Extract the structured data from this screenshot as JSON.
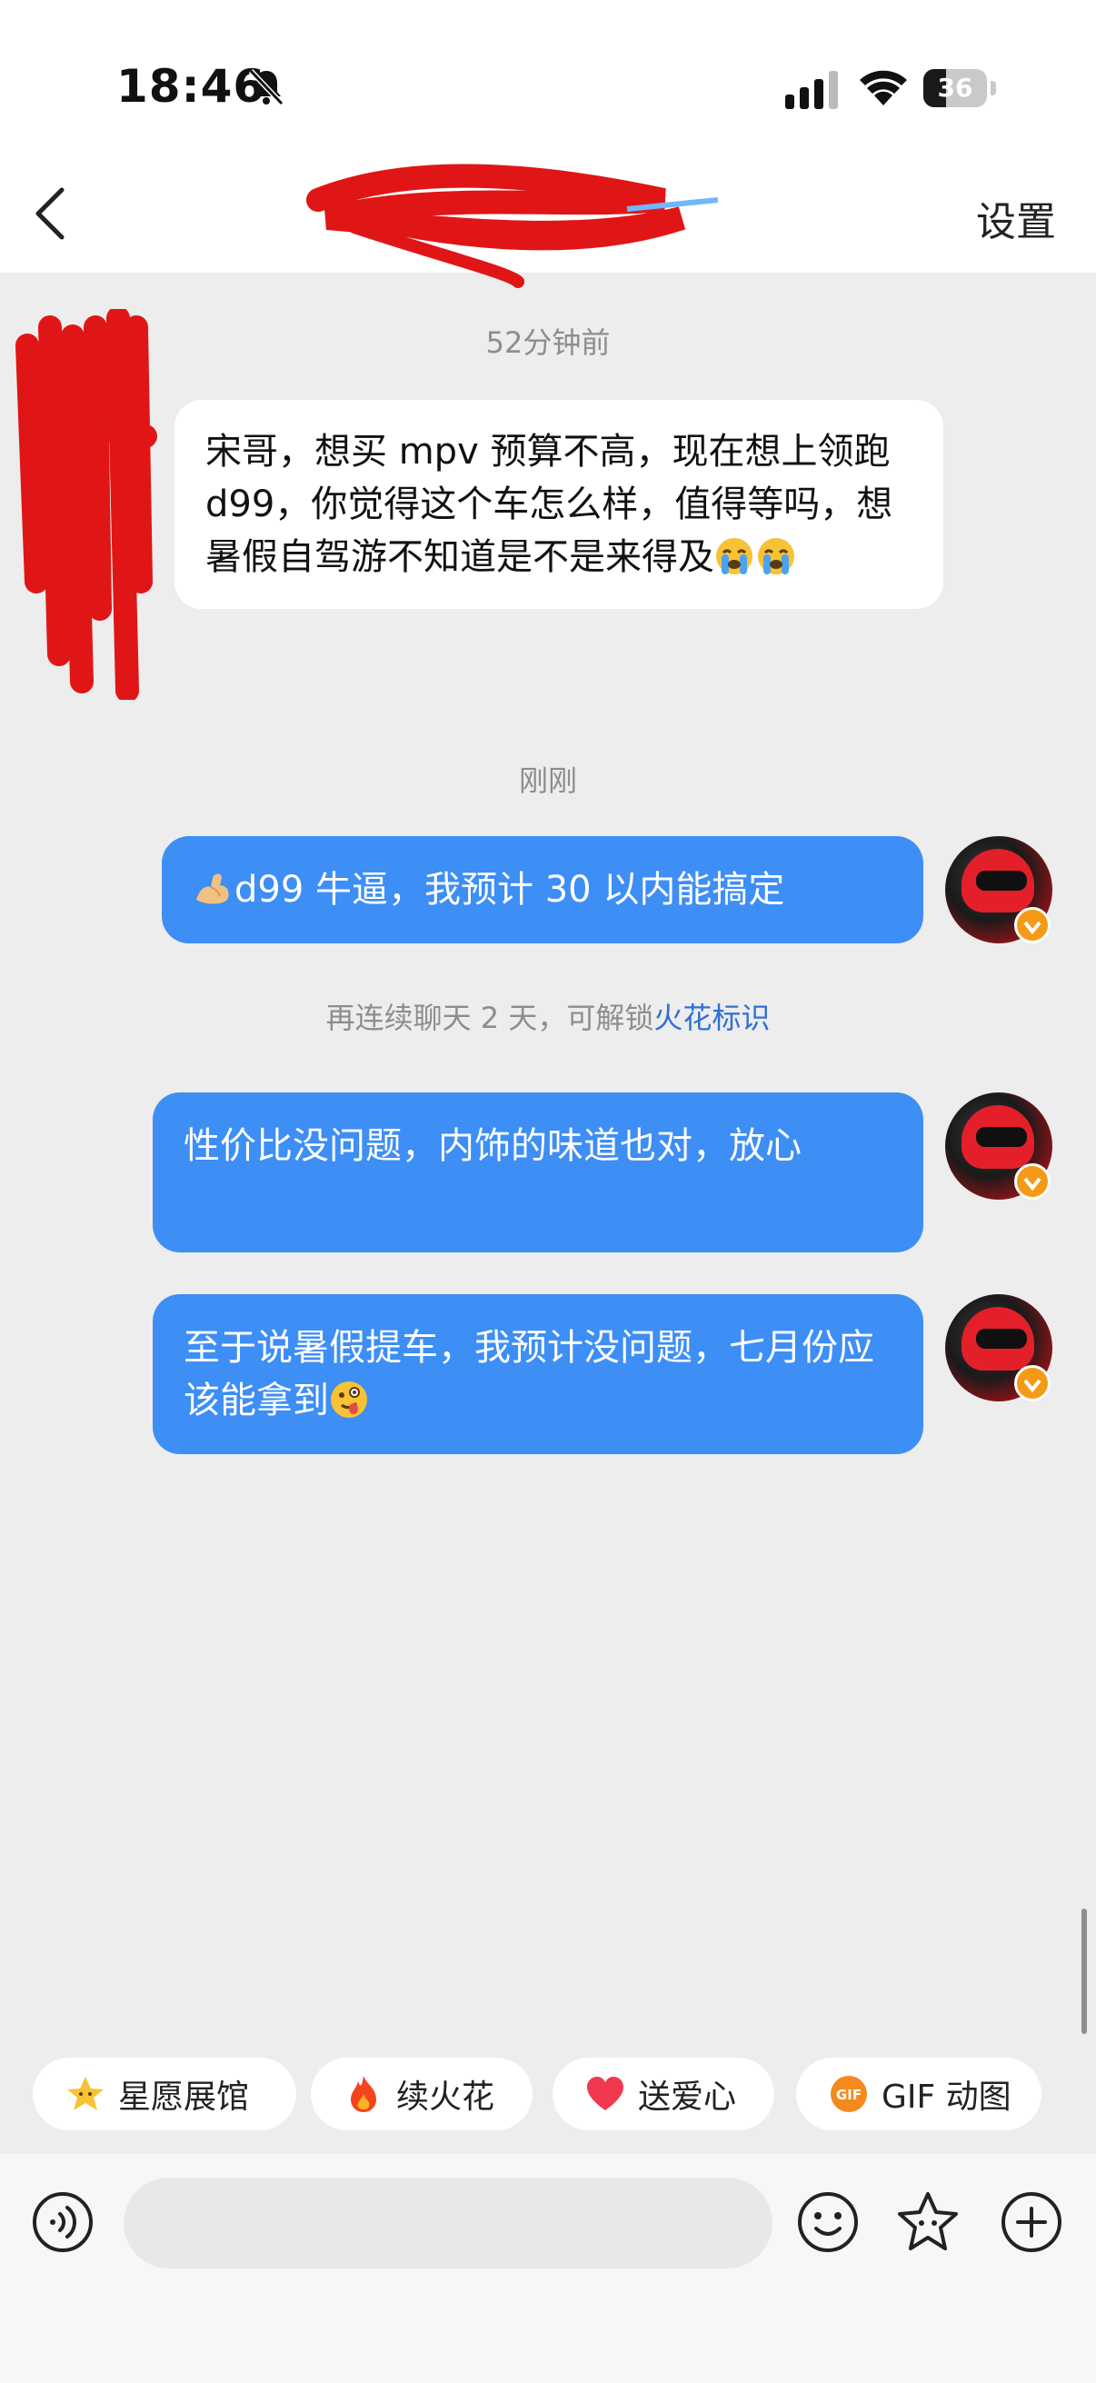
{
  "status_bar": {
    "time": "18:46",
    "battery": "36",
    "battery_level": 0.36
  },
  "nav": {
    "title": "",
    "settings_label": "设置"
  },
  "messages": {
    "ts1": "52分钟前",
    "incoming_text": "宋哥，想买 mpv 预算不高，现在想上领跑 d99，你觉得这个车怎么样，值得等吗，想暑假自驾游不知道是不是来得及",
    "ts2": "刚刚",
    "out1_text": "d99 牛逼，我预计 30 以内能搞定",
    "notice_text": "再连续聊天 2 天，可解锁",
    "notice_link": "火花标识",
    "out2_text": "性价比没问题，内饰的味道也对，放心",
    "out3_text": "至于说暑假提车，我预计没问题，七月份应该能拿到"
  },
  "quick_actions": [
    {
      "label": "星愿展馆",
      "icon": "star-icon"
    },
    {
      "label": "续火花",
      "icon": "flame-icon"
    },
    {
      "label": "送爱心",
      "icon": "heart-icon"
    },
    {
      "label": "GIF 动图",
      "icon": "gif-icon"
    }
  ],
  "input": {
    "placeholder": ""
  },
  "colors": {
    "bubble_out": "#3d8ef5",
    "bubble_in": "#ffffff",
    "background": "#ededed",
    "link": "#2f6fd6"
  }
}
